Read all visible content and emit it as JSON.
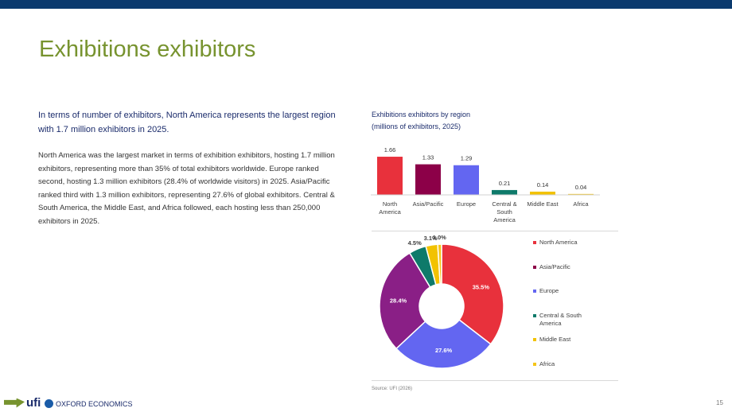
{
  "page": {
    "title": "Exhibitions exhibitors",
    "lead": "In terms of number of exhibitors, North America represents the largest region with 1.7 million exhibitors in 2025.",
    "body": "North America was the largest market in terms of exhibition exhibitors, hosting 1.7 million exhibitors, representing more than 35% of total exhibitors worldwide. Europe ranked second, hosting 1.3 million exhibitors (28.4% of worldwide visitors) in 2025. Asia/Pacific ranked third with 1.3 million exhibitors, representing 27.6% of global exhibitors. Central & South America, the Middle East, and Africa followed, each hosting less than 250,000 exhibitors in 2025.",
    "source": "Source: UFI (2026)",
    "page_number": "15"
  },
  "logos": {
    "ufi": "ufi",
    "oxford": "OXFORD ECONOMICS"
  },
  "colors": {
    "top_bar": "#0b3a6e",
    "title": "#77932f",
    "north_america": "#e8313c",
    "asia_pacific": "#8c0048",
    "europe": "#6366f1",
    "central_south_america": "#0e7a6a",
    "middle_east": "#f2c200",
    "africa": "#f5c518"
  },
  "chart_data": [
    {
      "type": "bar",
      "title": "Exhibitions exhibitors by region",
      "subtitle": "(millions of exhibitors, 2025)",
      "categories": [
        "North America",
        "Asia/Pacific",
        "Europe",
        "Central & South America",
        "Middle East",
        "Africa"
      ],
      "category_lines": [
        [
          "North",
          "America"
        ],
        [
          "Asia/Pacific"
        ],
        [
          "Europe"
        ],
        [
          "Central &",
          "South",
          "America"
        ],
        [
          "Middle East"
        ],
        [
          "Africa"
        ]
      ],
      "values": [
        1.66,
        1.33,
        1.29,
        0.21,
        0.14,
        0.04
      ],
      "labels": [
        "1.66",
        "1.33",
        "1.29",
        "0.21",
        "0.14",
        "0.04"
      ],
      "colors": [
        "#e8313c",
        "#8c0048",
        "#6366f1",
        "#0e7a6a",
        "#f2c200",
        "#f5c518"
      ],
      "ylim": [
        0,
        1.8
      ],
      "grid": false
    },
    {
      "type": "pie",
      "donut": true,
      "categories": [
        "North America",
        "Asia/Pacific",
        "Europe",
        "Central & South America",
        "Middle East",
        "Africa"
      ],
      "legend_lines": [
        [
          "North America"
        ],
        [
          "Asia/Pacific"
        ],
        [
          "Europe"
        ],
        [
          "Central & South",
          "America"
        ],
        [
          "Middle East"
        ],
        [
          "Africa"
        ]
      ],
      "slice_order": [
        "North America",
        "Europe",
        "Asia/Pacific",
        "Central & South America",
        "Middle East",
        "Africa"
      ],
      "values": [
        35.5,
        28.4,
        27.6,
        4.5,
        3.1,
        1.0
      ],
      "labels": [
        "35.5%",
        "28.4%",
        "27.6%",
        "4.5%",
        "3.1%",
        "1.0%"
      ],
      "slice_colors": [
        "#e8313c",
        "#8a1f86",
        "#6366f1",
        "#0e7a6a",
        "#f2c200",
        "#f5c518"
      ],
      "legend_colors": [
        "#e8313c",
        "#8c0048",
        "#6366f1",
        "#0e7a6a",
        "#f2c200",
        "#f5c518"
      ],
      "legend_position": "right"
    }
  ]
}
